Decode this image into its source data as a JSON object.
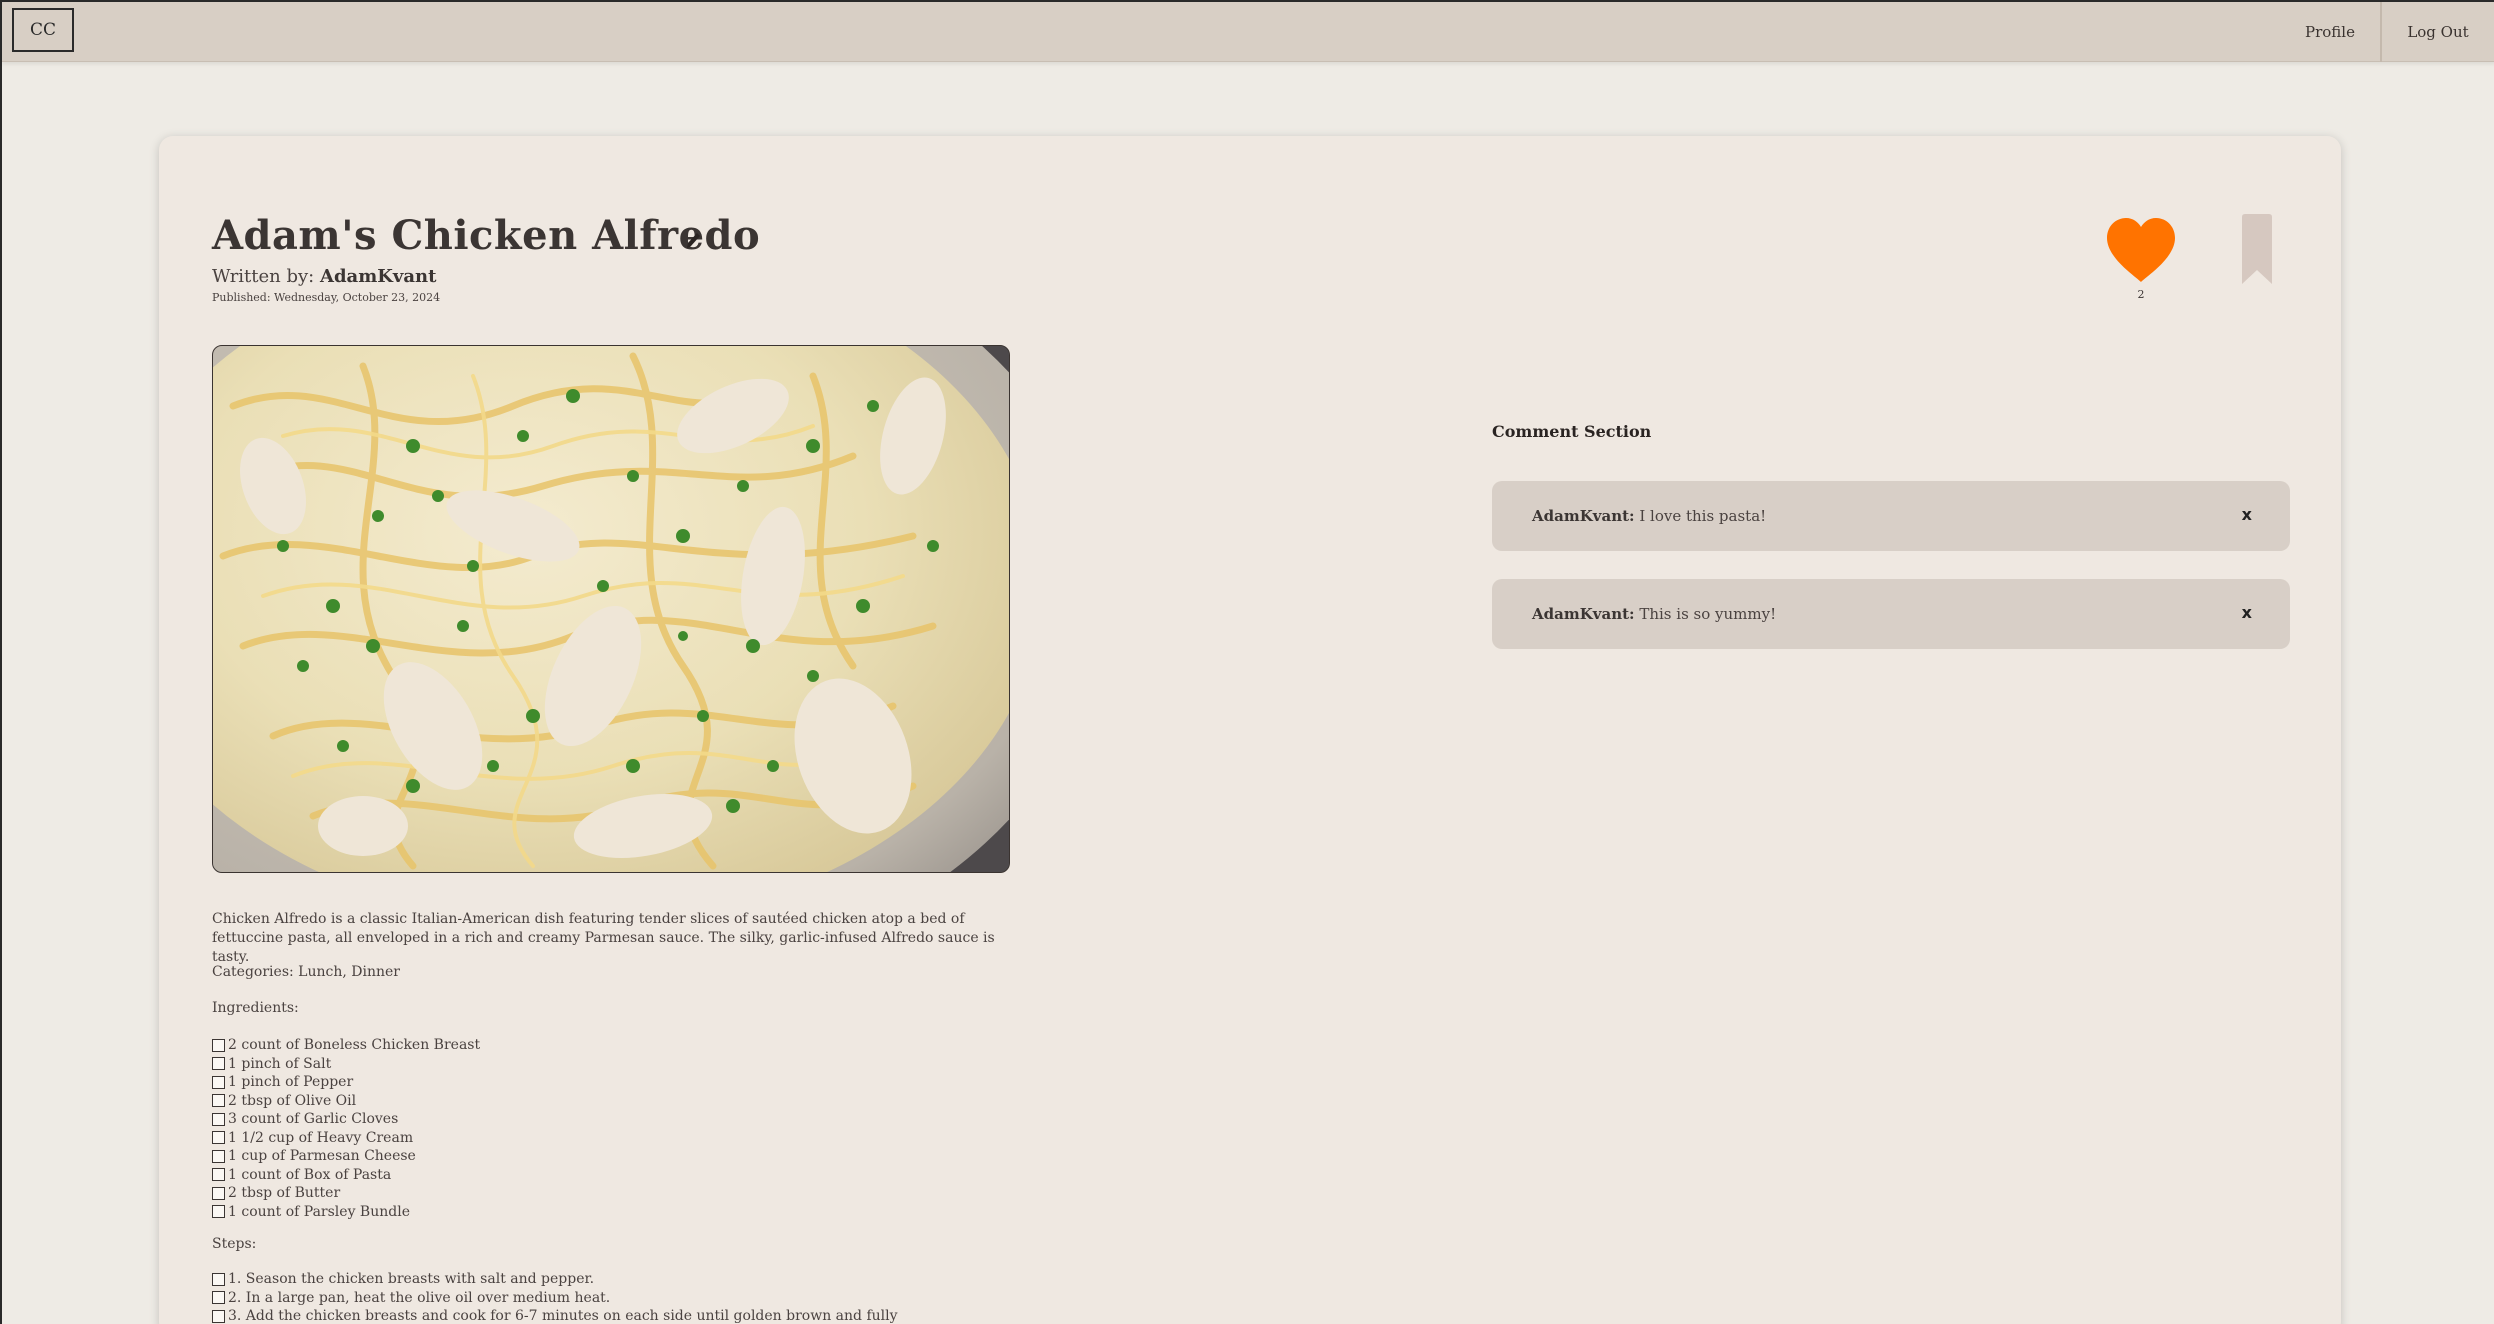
{
  "nav": {
    "logo": "CC",
    "profile": "Profile",
    "logout": "Log Out"
  },
  "recipe": {
    "title": "Adam's Chicken Alfredo",
    "written_by_label": "Written by:",
    "author": "AdamKvant",
    "published": "Published: Wednesday, October 23, 2024",
    "likes": "2",
    "description": "Chicken Alfredo is a classic Italian-American dish featuring tender slices of sautéed chicken atop a bed of fettuccine pasta, all enveloped in a rich and creamy Parmesan sauce. The silky, garlic-infused Alfredo sauce is tasty.",
    "categories": "Categories: Lunch, Dinner",
    "ingredients_heading": "Ingredients:",
    "ingredients": [
      "2 count of Boneless Chicken Breast",
      "1 pinch of Salt",
      "1 pinch of Pepper",
      "2 tbsp of Olive Oil",
      "3 count of Garlic Cloves",
      "1 1/2 cup of Heavy Cream",
      "1 cup of Parmesan Cheese",
      "1 count of Box of Pasta",
      "2 tbsp of Butter",
      "1 count of Parsley Bundle"
    ],
    "steps_heading": "Steps:",
    "steps": [
      "1. Season the chicken breasts with salt and pepper.",
      "2. In a large pan, heat the olive oil over medium heat.",
      "3. Add the chicken breasts and cook for 6-7 minutes on each side until golden brown and fully"
    ]
  },
  "comments": {
    "heading": "Comment Section",
    "close_label": "x",
    "items": [
      {
        "author": "AdamKvant:",
        "text": "I love this pasta!"
      },
      {
        "author": "AdamKvant:",
        "text": "This is so yummy!"
      }
    ]
  },
  "colors": {
    "heart": "#ff7300",
    "bookmark": "#d6c8c0",
    "nav_bg": "#d8cfc5",
    "card_bg": "#efe8e1",
    "comment_bg": "#d8cfc7"
  }
}
